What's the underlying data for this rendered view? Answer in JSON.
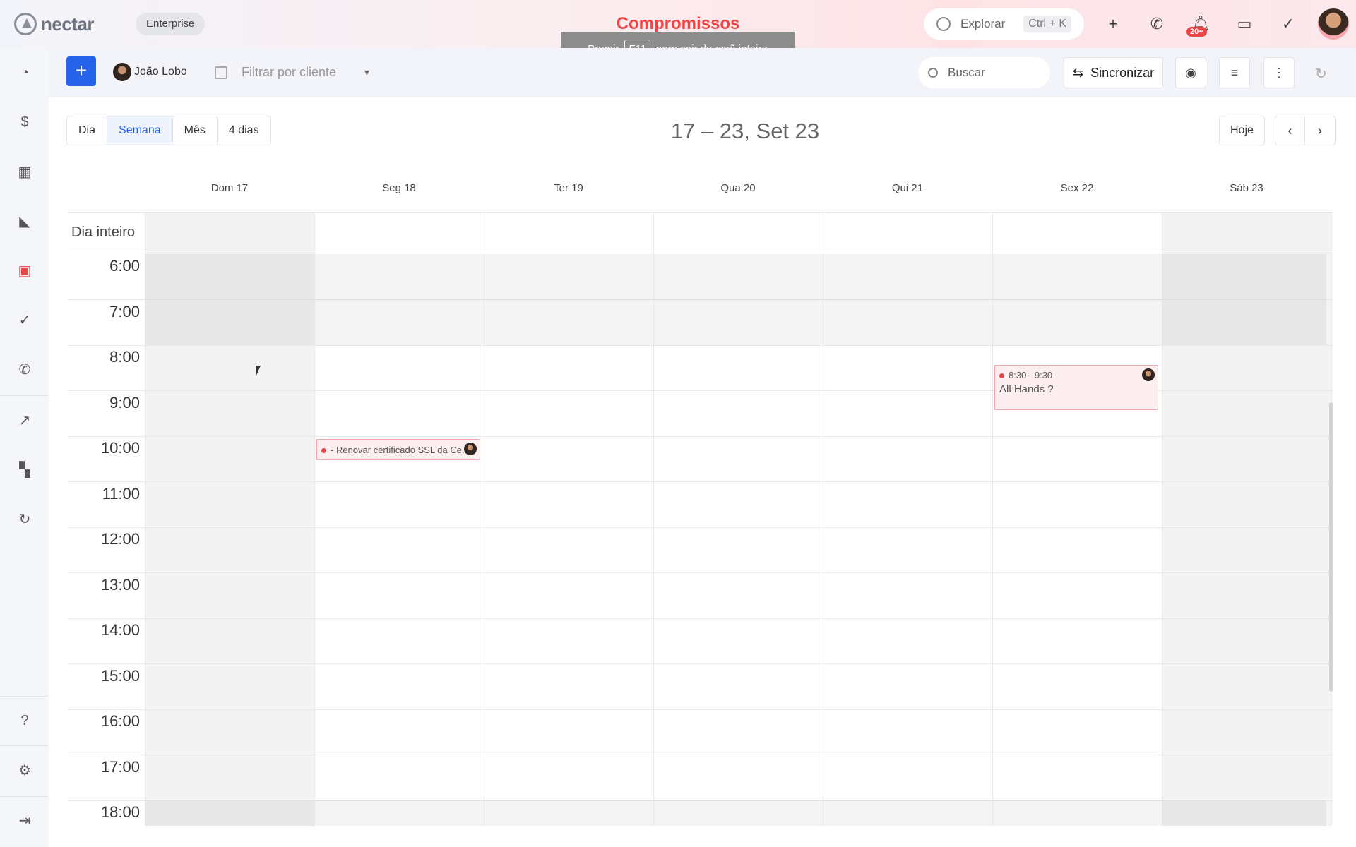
{
  "header": {
    "logo_text": "nectar",
    "plan_badge": "Enterprise",
    "page_title": "Compromissos",
    "explore_label": "Explorar",
    "explore_shortcut": "Ctrl + K",
    "notification_count": "20+"
  },
  "fullscreen_tip": {
    "prefix": "Premir",
    "key": "F11",
    "suffix": "para sair do ecrã inteiro"
  },
  "toolbar": {
    "add_label": "+",
    "user_name": "João Lobo",
    "client_filter_placeholder": "Filtrar por cliente",
    "search_placeholder": "Buscar",
    "sync_label": "Sincronizar"
  },
  "views": {
    "day": "Dia",
    "week": "Semana",
    "month": "Mês",
    "four_days": "4 dias",
    "active": "Semana"
  },
  "range_title": "17 – 23, Set 23",
  "today_label": "Hoje",
  "days": [
    "Dom 17",
    "Seg 18",
    "Ter 19",
    "Qua 20",
    "Qui 21",
    "Sex 22",
    "Sáb 23"
  ],
  "all_day_label": "Dia inteiro",
  "hours": [
    "6:00",
    "7:00",
    "8:00",
    "9:00",
    "10:00",
    "11:00",
    "12:00",
    "13:00",
    "14:00",
    "15:00",
    "16:00",
    "17:00",
    "18:00"
  ],
  "events": [
    {
      "day": "Seg 18",
      "time": "",
      "title": "- Renovar certificado SSL da Ce..."
    },
    {
      "day": "Sex 22",
      "time": "8:30 - 9:30",
      "title": "All Hands ?"
    }
  ],
  "colors": {
    "accent": "#2563eb",
    "brand_red": "#ef4444"
  }
}
